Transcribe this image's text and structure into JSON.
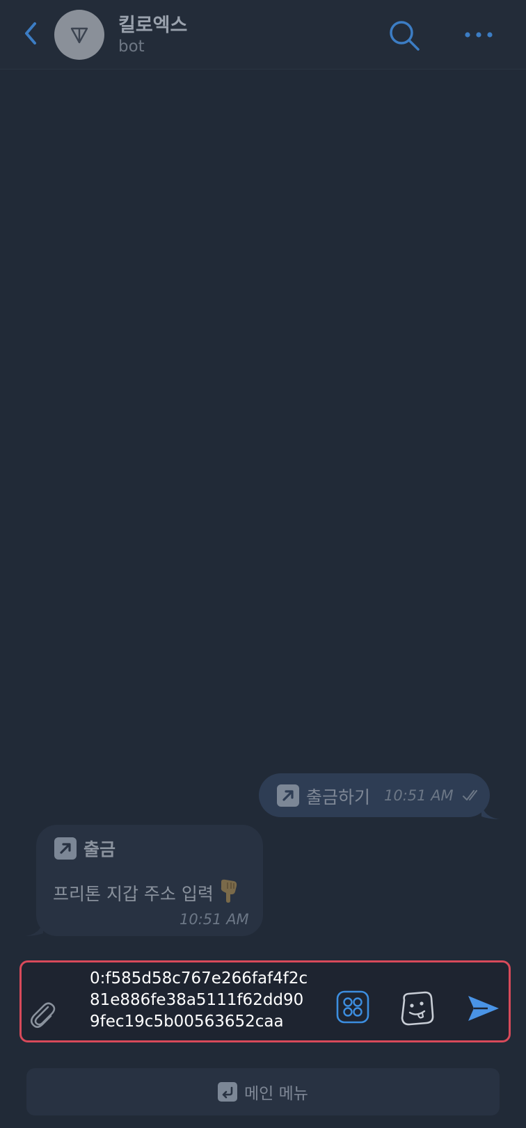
{
  "header": {
    "title": "킬로엑스",
    "subtitle": "bot"
  },
  "messages": [
    {
      "direction": "outgoing",
      "icon": "arrow-up-right-icon",
      "text": "출금하기",
      "time": "10:51 AM",
      "status": "read"
    },
    {
      "direction": "incoming",
      "icon": "arrow-up-right-icon",
      "title": "출금",
      "body": "프리톤 지갑 주소 입력",
      "emoji": "backhand-index-pointing-down",
      "time": "10:51 AM"
    }
  ],
  "composer": {
    "value": "0:f585d58c767e266faf4f2c81e886fe38a5111f62dd909fec19c5b00563652caa"
  },
  "keyboard": {
    "main_menu_label": "메인 메뉴"
  },
  "colors": {
    "accent": "#3c8ee0",
    "background": "#212a37",
    "focus_border": "#d84a5a"
  }
}
